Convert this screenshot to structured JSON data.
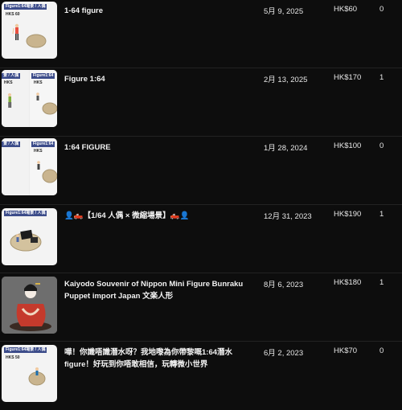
{
  "rows": [
    {
      "title": "1-64 figure",
      "date": "5月 9, 2025",
      "price": "HK$60",
      "qty": "0",
      "thumb_tags": [
        "Figure1:64場景 / 人偶",
        "HKS 60"
      ]
    },
    {
      "title": "Figure 1:64",
      "date": "2月 13, 2025",
      "price": "HK$170",
      "qty": "1",
      "thumb_tags": [
        "景 / 人偶",
        "Figure1:64",
        "HKS",
        "HKS"
      ]
    },
    {
      "title": "1:64 FIGURE",
      "date": "1月 28, 2024",
      "price": "HK$100",
      "qty": "0",
      "thumb_tags": [
        "景 / 人偶",
        "Figure1:64",
        "HKS"
      ]
    },
    {
      "title": "👤🛻【1/64 人偶 × 微縮場景】🛻👤",
      "date": "12月 31, 2023",
      "price": "HK$190",
      "qty": "1",
      "thumb_tags": [
        "Figure1:64場景 / 人偶"
      ]
    },
    {
      "title": "Kaiyodo Souvenir of Nippon Mini Figure Bunraku Puppet import Japan 文楽人形",
      "date": "8月 6, 2023",
      "price": "HK$180",
      "qty": "1",
      "thumb_tags": []
    },
    {
      "title": "嘩！你識唔識潛水呀？我地嚟為你帶黎嘅1:64潛水figure！好玩到你唔敢相信，玩轉微小世界",
      "date": "6月 2, 2023",
      "price": "HK$70",
      "qty": "0",
      "thumb_tags": [
        "Figure1:64場景 / 人偶",
        "HKS 50"
      ]
    }
  ],
  "colors": {
    "background": "#0d0d0d",
    "text": "#f2f2f2",
    "tag": "#3c4c8a"
  },
  "icons": [
    "thumbnail-figure-image"
  ]
}
